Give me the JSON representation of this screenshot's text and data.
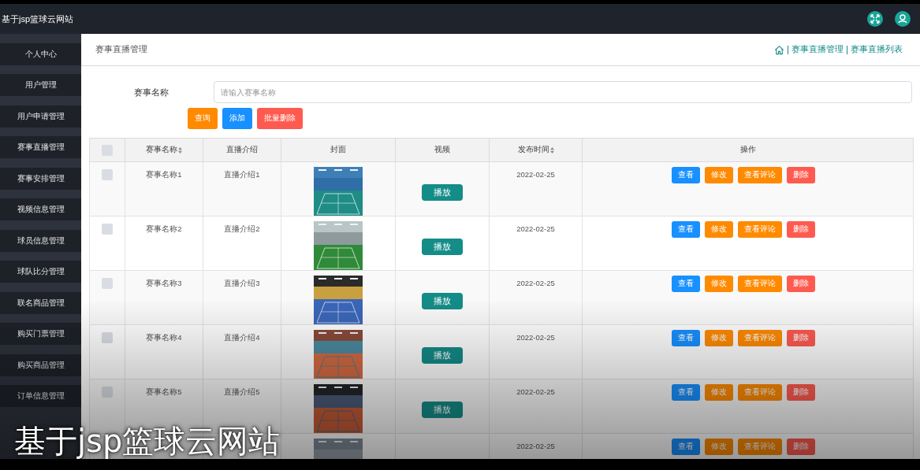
{
  "header": {
    "title": "基于jsp篮球云网站"
  },
  "sidebar": {
    "items": [
      {
        "label": "个人中心"
      },
      {
        "label": "用户管理"
      },
      {
        "label": "用户申请管理"
      },
      {
        "label": "赛事直播管理"
      },
      {
        "label": "赛事安排管理"
      },
      {
        "label": "视频信息管理"
      },
      {
        "label": "球员信息管理"
      },
      {
        "label": "球队比分管理"
      },
      {
        "label": "联名商品管理"
      },
      {
        "label": "购买门票管理"
      },
      {
        "label": "购买商品管理"
      },
      {
        "label": "订单信息管理"
      }
    ]
  },
  "page": {
    "title": "赛事直播管理",
    "breadcrumb": [
      "赛事直播管理",
      "赛事直播列表"
    ]
  },
  "search": {
    "label": "赛事名称",
    "placeholder": "请输入赛事名称",
    "buttons": [
      {
        "label": "查询",
        "kind": "query"
      },
      {
        "label": "添加",
        "kind": "add"
      },
      {
        "label": "批量删除",
        "kind": "delete"
      }
    ]
  },
  "table": {
    "header_checked": false,
    "columns": [
      {
        "label": "赛事名称",
        "sortable": true
      },
      {
        "label": "直播介绍",
        "sortable": false
      },
      {
        "label": "封面",
        "sortable": false
      },
      {
        "label": "视频",
        "sortable": false
      },
      {
        "label": "发布时间",
        "sortable": true
      },
      {
        "label": "操作",
        "sortable": false
      }
    ],
    "rows": [
      {
        "checked": false,
        "name": "赛事名称1",
        "intro": "直播介绍1",
        "video_button": "播放",
        "date": "2022-02-25",
        "actions": [
          {
            "label": "查看",
            "kind": "view"
          },
          {
            "label": "修改",
            "kind": "edit"
          },
          {
            "label": "查看评论",
            "kind": "comments"
          },
          {
            "label": "删除",
            "kind": "delete"
          }
        ]
      },
      {
        "checked": false,
        "name": "赛事名称2",
        "intro": "直播介绍2",
        "video_button": "播放",
        "date": "2022-02-25",
        "actions": [
          {
            "label": "查看",
            "kind": "view"
          },
          {
            "label": "修改",
            "kind": "edit"
          },
          {
            "label": "查看评论",
            "kind": "comments"
          },
          {
            "label": "删除",
            "kind": "delete"
          }
        ]
      },
      {
        "checked": false,
        "name": "赛事名称3",
        "intro": "直播介绍3",
        "video_button": "播放",
        "date": "2022-02-25",
        "actions": [
          {
            "label": "查看",
            "kind": "view"
          },
          {
            "label": "修改",
            "kind": "edit"
          },
          {
            "label": "查看评论",
            "kind": "comments"
          },
          {
            "label": "删除",
            "kind": "delete"
          }
        ]
      },
      {
        "checked": false,
        "name": "赛事名称4",
        "intro": "直播介绍4",
        "video_button": "播放",
        "date": "2022-02-25",
        "actions": [
          {
            "label": "查看",
            "kind": "view"
          },
          {
            "label": "修改",
            "kind": "edit"
          },
          {
            "label": "查看评论",
            "kind": "comments"
          },
          {
            "label": "删除",
            "kind": "delete"
          }
        ]
      },
      {
        "checked": false,
        "name": "赛事名称5",
        "intro": "直播介绍5",
        "video_button": "播放",
        "date": "2022-02-25",
        "actions": [
          {
            "label": "查看",
            "kind": "view"
          },
          {
            "label": "修改",
            "kind": "edit"
          },
          {
            "label": "查看评论",
            "kind": "comments"
          },
          {
            "label": "删除",
            "kind": "delete"
          }
        ]
      },
      {
        "date": "2022-02-25",
        "actions": [
          {
            "label": "查看",
            "kind": "view"
          },
          {
            "label": "修改",
            "kind": "edit"
          },
          {
            "label": "查看评论",
            "kind": "comments"
          },
          {
            "label": "删除",
            "kind": "delete"
          }
        ]
      }
    ]
  },
  "caption": "基于jsp篮球云网站"
}
